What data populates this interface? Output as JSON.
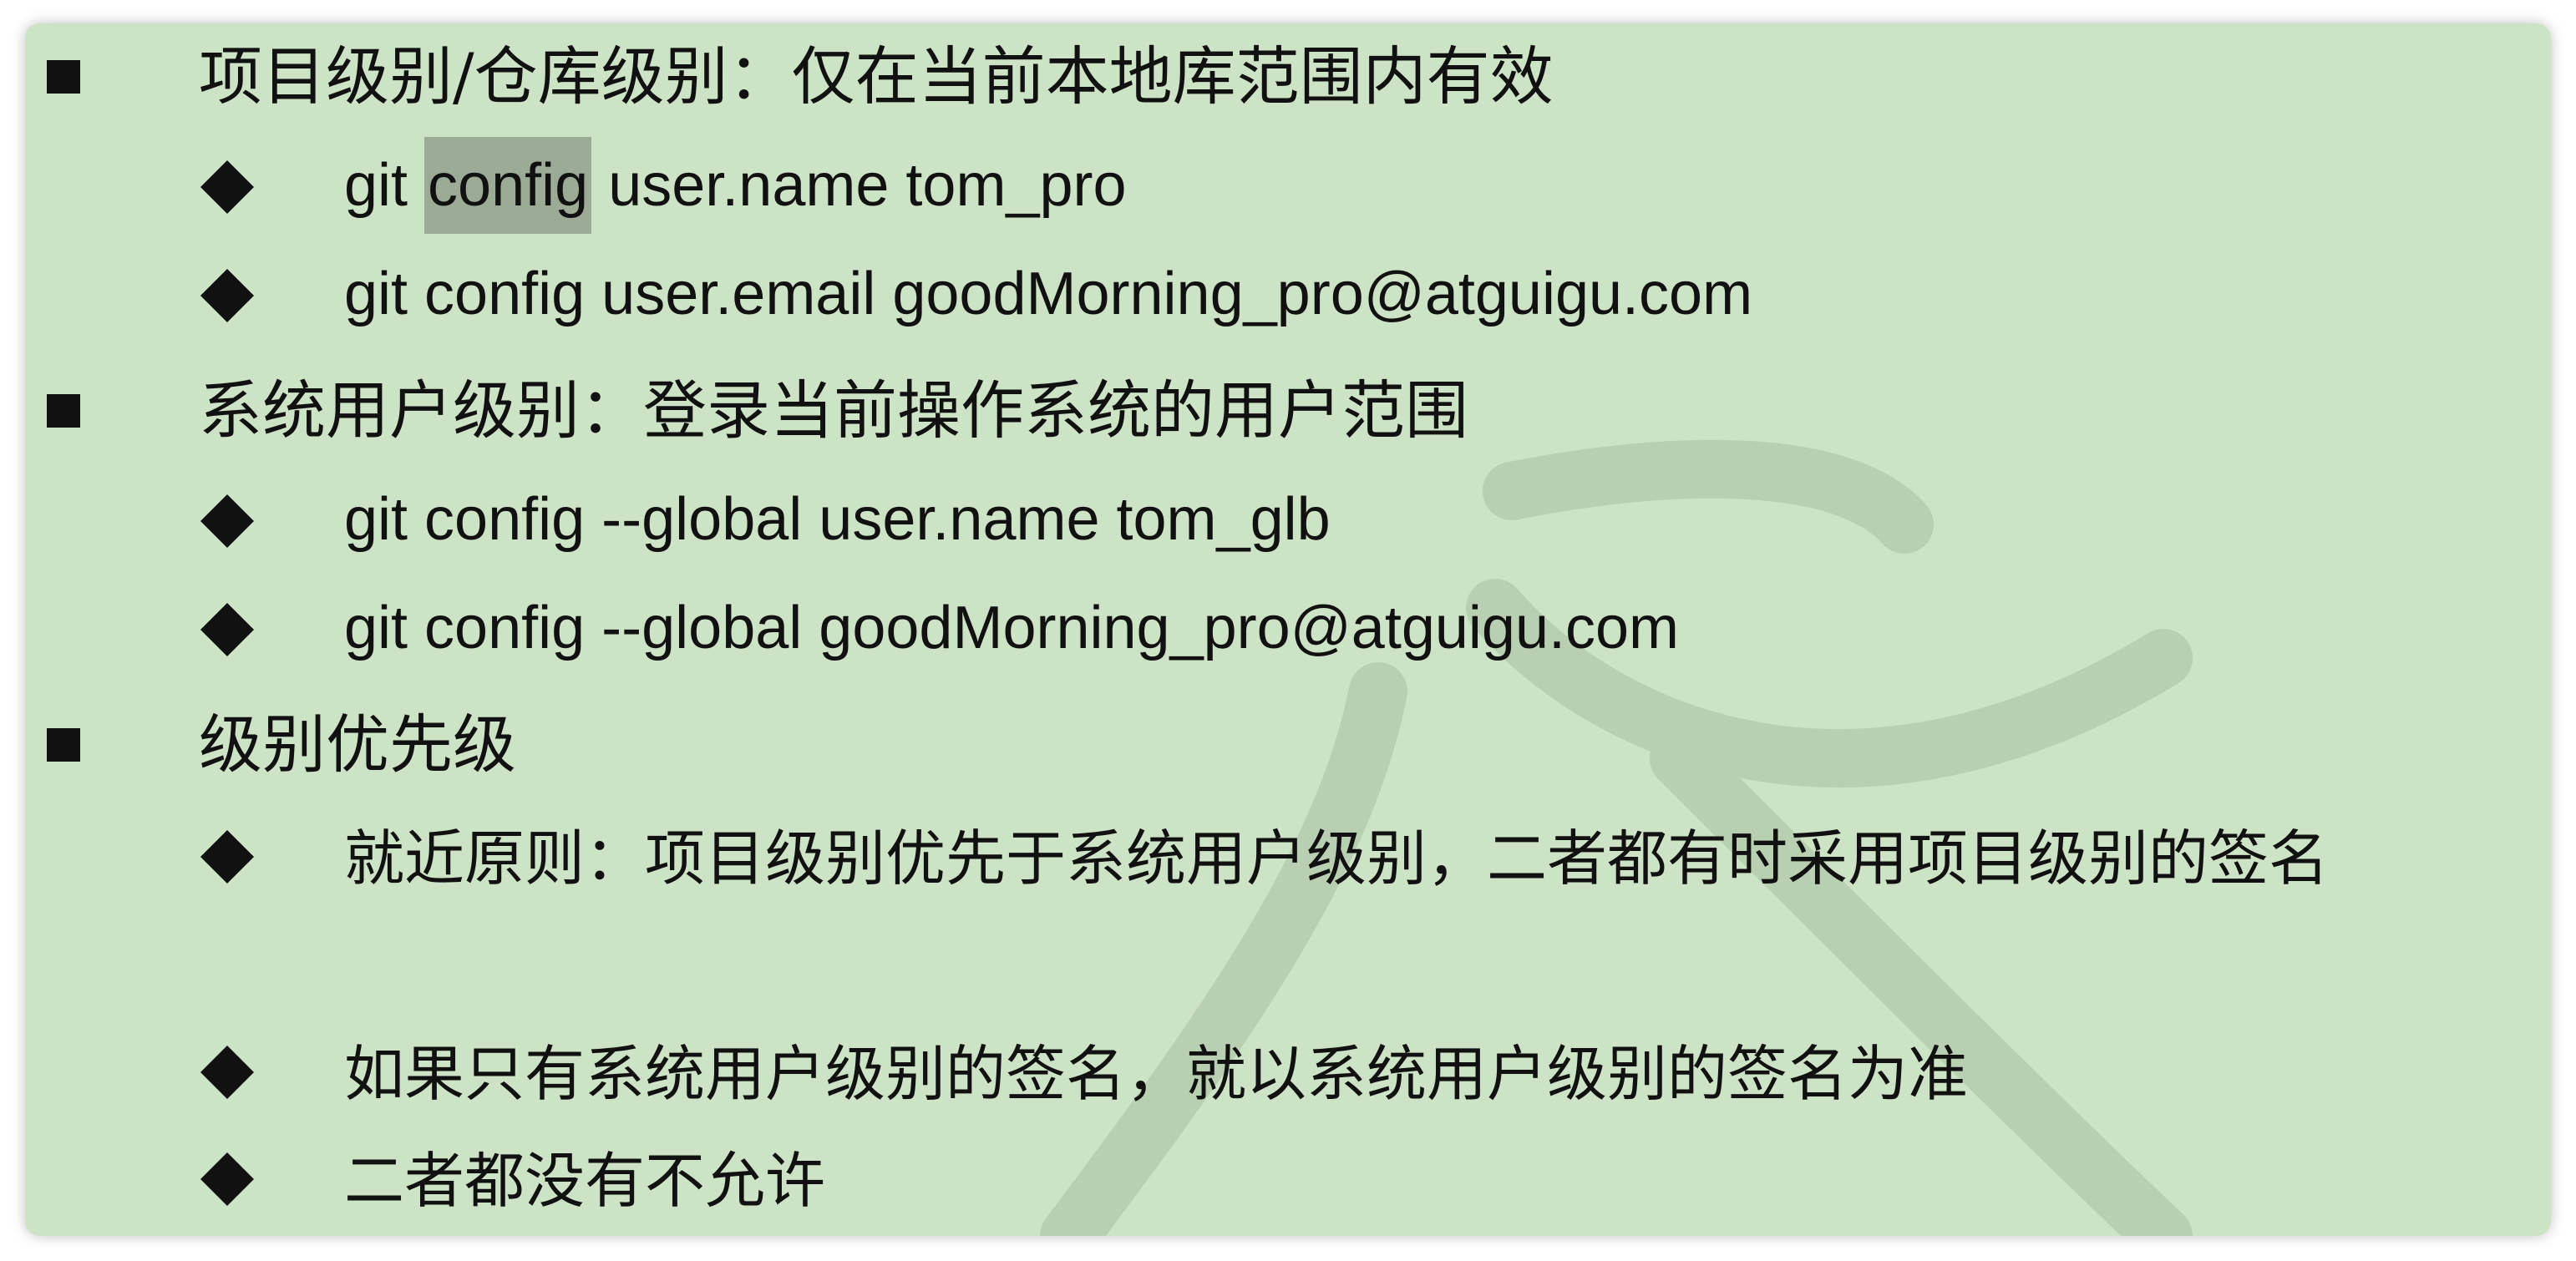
{
  "level1": [
    {
      "text": "项目级别/仓库级别：仅在当前本地库范围内有效",
      "items": [
        {
          "prefix": "git ",
          "highlight": "config",
          "suffix": " user.name tom_pro"
        },
        {
          "text": "git config user.email goodMorning_pro@atguigu.com"
        }
      ]
    },
    {
      "text": "系统用户级别：登录当前操作系统的用户范围",
      "items": [
        {
          "text": "git config --global user.name tom_glb"
        },
        {
          "text": "git config --global goodMorning_pro@atguigu.com"
        }
      ]
    },
    {
      "text": "级别优先级",
      "items": [
        {
          "text": "就近原则：项目级别优先于系统用户级别，二者都有时采用项目级别的签名"
        },
        {
          "text": "如果只有系统用户级别的签名，就以系统用户级别的签名为准"
        },
        {
          "text": "二者都没有不允许"
        }
      ]
    }
  ],
  "colors": {
    "slide_background": "#cde3c5",
    "highlight": "#9bab95",
    "text": "#111111"
  }
}
